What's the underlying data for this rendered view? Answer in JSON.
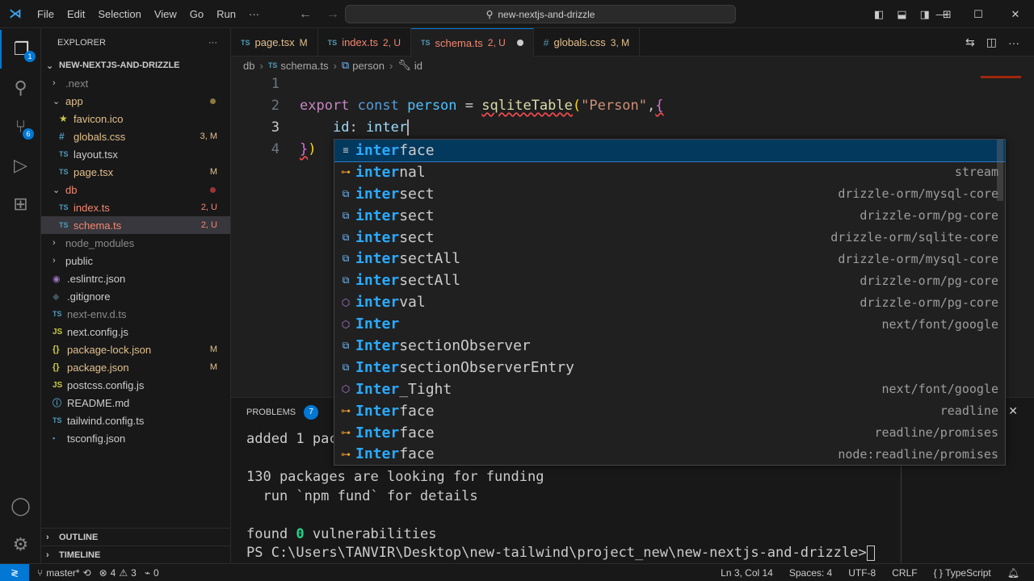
{
  "titlebar": {
    "menus": [
      "File",
      "Edit",
      "Selection",
      "View",
      "Go",
      "Run",
      "···"
    ],
    "search_text": "new-nextjs-and-drizzle"
  },
  "activity": {
    "scm_badge": "6",
    "explorer_badge": "1"
  },
  "explorer": {
    "title": "EXPLORER",
    "more": "···",
    "root": "NEW-NEXTJS-AND-DRIZZLE",
    "items": [
      {
        "label": ".next",
        "status": "",
        "kind": "folder-closed",
        "depth": 0,
        "color": "dim",
        "icon": ""
      },
      {
        "label": "app",
        "status": "",
        "kind": "folder-open",
        "depth": 0,
        "color": "mod",
        "icon": "",
        "dot": "mod"
      },
      {
        "label": "favicon.ico",
        "status": "",
        "kind": "file",
        "depth": 1,
        "color": "mod",
        "icon": "★"
      },
      {
        "label": "globals.css",
        "status": "3, M",
        "kind": "file",
        "depth": 1,
        "color": "mod",
        "icon": "#"
      },
      {
        "label": "layout.tsx",
        "status": "",
        "kind": "file",
        "depth": 1,
        "color": "norm",
        "icon": "TS"
      },
      {
        "label": "page.tsx",
        "status": "M",
        "kind": "file",
        "depth": 1,
        "color": "mod",
        "icon": "TS"
      },
      {
        "label": "db",
        "status": "",
        "kind": "folder-open",
        "depth": 0,
        "color": "untr",
        "icon": "",
        "dot": "err"
      },
      {
        "label": "index.ts",
        "status": "2, U",
        "kind": "file",
        "depth": 1,
        "color": "untr",
        "icon": "TS"
      },
      {
        "label": "schema.ts",
        "status": "2, U",
        "kind": "file",
        "depth": 1,
        "color": "untr",
        "icon": "TS",
        "selected": true
      },
      {
        "label": "node_modules",
        "status": "",
        "kind": "folder-closed",
        "depth": 0,
        "color": "dim",
        "icon": ""
      },
      {
        "label": "public",
        "status": "",
        "kind": "folder-closed",
        "depth": 0,
        "color": "norm",
        "icon": ""
      },
      {
        "label": ".eslintrc.json",
        "status": "",
        "kind": "file",
        "depth": 0,
        "color": "norm",
        "icon": "◉"
      },
      {
        "label": ".gitignore",
        "status": "",
        "kind": "file",
        "depth": 0,
        "color": "norm",
        "icon": "◆"
      },
      {
        "label": "next-env.d.ts",
        "status": "",
        "kind": "file",
        "depth": 0,
        "color": "dim",
        "icon": "TS"
      },
      {
        "label": "next.config.js",
        "status": "",
        "kind": "file",
        "depth": 0,
        "color": "norm",
        "icon": "JS"
      },
      {
        "label": "package-lock.json",
        "status": "M",
        "kind": "file",
        "depth": 0,
        "color": "mod",
        "icon": "{}"
      },
      {
        "label": "package.json",
        "status": "M",
        "kind": "file",
        "depth": 0,
        "color": "mod",
        "icon": "{}"
      },
      {
        "label": "postcss.config.js",
        "status": "",
        "kind": "file",
        "depth": 0,
        "color": "norm",
        "icon": "JS"
      },
      {
        "label": "README.md",
        "status": "",
        "kind": "file",
        "depth": 0,
        "color": "norm",
        "icon": "ⓘ"
      },
      {
        "label": "tailwind.config.ts",
        "status": "",
        "kind": "file",
        "depth": 0,
        "color": "norm",
        "icon": "TS"
      },
      {
        "label": "tsconfig.json",
        "status": "",
        "kind": "file",
        "depth": 0,
        "color": "norm",
        "icon": "▪"
      }
    ],
    "outline": "OUTLINE",
    "timeline": "TIMELINE"
  },
  "tabs": [
    {
      "icon": "TS",
      "label": "page.tsx",
      "status": "M",
      "color": "mod",
      "active": false
    },
    {
      "icon": "TS",
      "label": "index.ts",
      "status": "2, U",
      "color": "untr",
      "active": false
    },
    {
      "icon": "TS",
      "label": "schema.ts",
      "status": "2, U",
      "color": "untr",
      "active": true,
      "dirty": true
    },
    {
      "icon": "#",
      "label": "globals.css",
      "status": "3, M",
      "color": "mod",
      "active": false
    }
  ],
  "breadcrumb": {
    "folder": "db",
    "file_icon": "TS",
    "file": "schema.ts",
    "symbol1": "person",
    "symbol2": "id"
  },
  "editor": {
    "line_numbers": [
      "1",
      "2",
      "3",
      "4"
    ],
    "line2": {
      "kw_export": "export",
      "kw_const": "const",
      "var": "person",
      "eq": "=",
      "fn": "sqliteTable",
      "paren": "(",
      "str": "\"Person\"",
      "comma": ",",
      "brace": "{"
    },
    "line3": {
      "prop": "id",
      "colon": ":",
      "typed": "inter"
    },
    "line4": {
      "brace": "}",
      "paren": ")"
    }
  },
  "suggestions": [
    {
      "icon": "keyword",
      "match": "inter",
      "rest": "face",
      "detail": ""
    },
    {
      "icon": "interface",
      "match": "inter",
      "rest": "nal",
      "detail": "stream"
    },
    {
      "icon": "module",
      "match": "inter",
      "rest": "sect",
      "detail": "drizzle-orm/mysql-core"
    },
    {
      "icon": "module",
      "match": "inter",
      "rest": "sect",
      "detail": "drizzle-orm/pg-core"
    },
    {
      "icon": "module",
      "match": "inter",
      "rest": "sect",
      "detail": "drizzle-orm/sqlite-core"
    },
    {
      "icon": "module",
      "match": "inter",
      "rest": "sectAll",
      "detail": "drizzle-orm/mysql-core"
    },
    {
      "icon": "module",
      "match": "inter",
      "rest": "sectAll",
      "detail": "drizzle-orm/pg-core"
    },
    {
      "icon": "field",
      "match": "inter",
      "rest": "val",
      "detail": "drizzle-orm/pg-core"
    },
    {
      "icon": "field",
      "match": "Inter",
      "rest": "",
      "detail": "next/font/google"
    },
    {
      "icon": "module",
      "match": "Inter",
      "rest": "sectionObserver",
      "detail": ""
    },
    {
      "icon": "module",
      "match": "Inter",
      "rest": "sectionObserverEntry",
      "detail": ""
    },
    {
      "icon": "field",
      "match": "Inter",
      "rest": "_Tight",
      "detail": "next/font/google"
    },
    {
      "icon": "interface",
      "match": "Inter",
      "rest": "face",
      "detail": "readline"
    },
    {
      "icon": "interface",
      "match": "Inter",
      "rest": "face",
      "detail": "readline/promises"
    },
    {
      "icon": "interface",
      "match": "Inter",
      "rest": "face",
      "detail": "node:readline/promises"
    }
  ],
  "panel": {
    "problems_label": "PROBLEMS",
    "problems_count": "7",
    "next_tab_partial": "O",
    "close": "✕",
    "terminal": {
      "line1_start": "added 1 pac",
      "line2": "",
      "line3": "130 packages are looking for funding",
      "line4": "  run `npm fund` for details",
      "line5": "",
      "found_prefix": "found ",
      "found_count": "0",
      "found_suffix": " vulnerabilities",
      "prompt": "PS C:\\Users\\TANVIR\\Desktop\\new-tailwind\\project_new\\new-nextjs-and-drizzle>"
    }
  },
  "statusbar": {
    "branch": "master*",
    "errors": "4",
    "warnings": "3",
    "ports": "0",
    "position": "Ln 3, Col 14",
    "spaces": "Spaces: 4",
    "encoding": "UTF-8",
    "eol": "CRLF",
    "language": "TypeScript"
  }
}
